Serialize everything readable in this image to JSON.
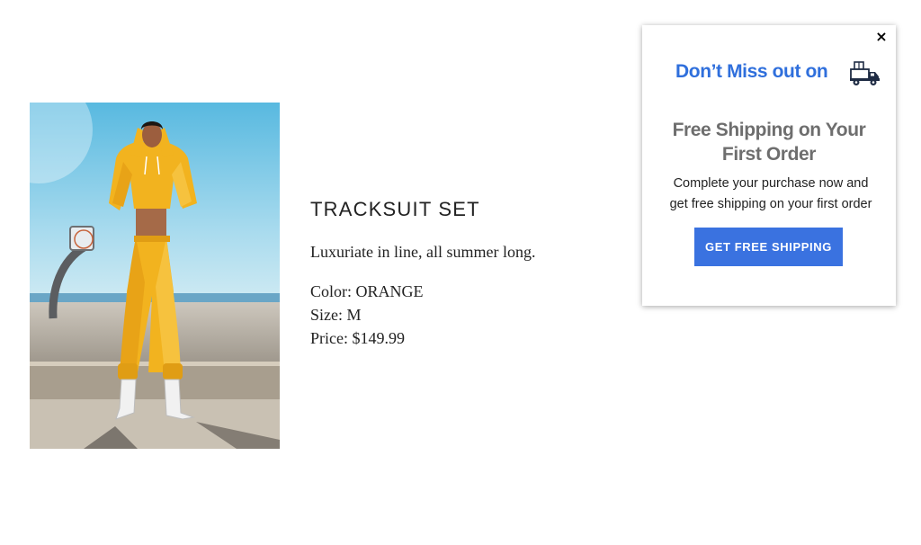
{
  "product": {
    "title": "TRACKSUIT SET",
    "tagline": "Luxuriate in line, all summer long.",
    "color_line": "Color: ORANGE",
    "size_line": "Size: M",
    "price_line": "Price: $149.99"
  },
  "popup": {
    "close_label": "×",
    "headline": "Don’t Miss out on",
    "subhead_line1": "Free Shipping on Your",
    "subhead_line2": "First Order",
    "body_line1": "Complete your purchase now and",
    "body_line2": "get free shipping on your first order",
    "cta_label": "GET FREE SHIPPING",
    "icon": "delivery-truck-icon"
  },
  "colors": {
    "accent_blue": "#2f6fdc",
    "button_blue": "#3a72e0",
    "subhead_gray": "#6e6e6e",
    "tracksuit_yellow": "#f2b31f"
  }
}
